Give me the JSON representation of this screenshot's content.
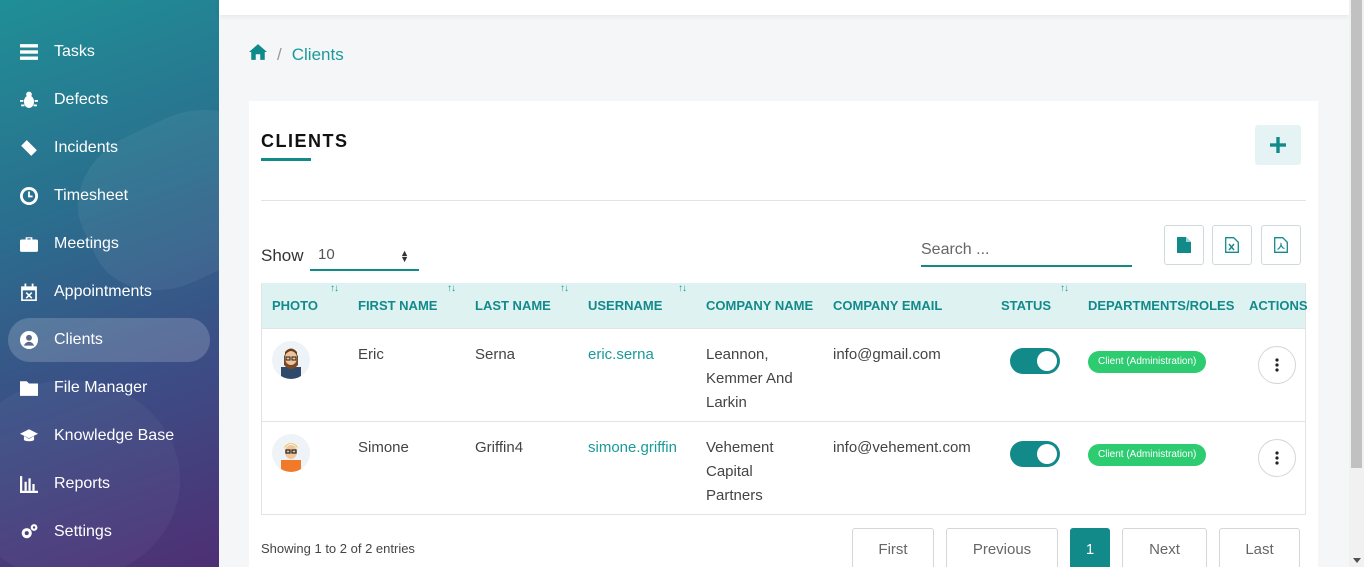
{
  "sidebar": {
    "items": [
      {
        "label": "Tasks",
        "icon": "tasks-icon"
      },
      {
        "label": "Defects",
        "icon": "bug-icon"
      },
      {
        "label": "Incidents",
        "icon": "ticket-icon"
      },
      {
        "label": "Timesheet",
        "icon": "clock-icon"
      },
      {
        "label": "Meetings",
        "icon": "briefcase-icon"
      },
      {
        "label": "Appointments",
        "icon": "calendar-icon"
      },
      {
        "label": "Clients",
        "icon": "user-circle-icon",
        "active": true
      },
      {
        "label": "File Manager",
        "icon": "folder-icon"
      },
      {
        "label": "Knowledge Base",
        "icon": "graduation-cap-icon"
      },
      {
        "label": "Reports",
        "icon": "bar-chart-icon"
      },
      {
        "label": "Settings",
        "icon": "gears-icon"
      }
    ]
  },
  "breadcrumb": {
    "current": "Clients",
    "separator": "/"
  },
  "card": {
    "title": "CLIENTS"
  },
  "controls": {
    "show_label": "Show",
    "show_value": "10",
    "search_placeholder": "Search ..."
  },
  "table": {
    "headers": {
      "photo": "PHOTO",
      "first_name": "FIRST NAME",
      "last_name": "LAST NAME",
      "username": "USERNAME",
      "company_name": "COMPANY NAME",
      "company_email": "COMPANY EMAIL",
      "status": "STATUS",
      "departments": "DEPARTMENTS/ROLES",
      "actions": "ACTIONS"
    },
    "sort_glyph": "↑↓",
    "rows": [
      {
        "first_name": "Eric",
        "last_name": "Serna",
        "username": "eric.serna",
        "company_line1": "Leannon,",
        "company_line2": "Kemmer And",
        "company_line3": "Larkin",
        "email": "info@gmail.com",
        "status_on": true,
        "role": "Client (Administration)"
      },
      {
        "first_name": "Simone",
        "last_name": "Griffin4",
        "username": "simone.griffin",
        "company_line1": "Vehement",
        "company_line2": "Capital",
        "company_line3": "Partners",
        "email": "info@vehement.com",
        "status_on": true,
        "role": "Client (Administration)"
      }
    ]
  },
  "footer": {
    "info": "Showing 1 to 2 of 2 entries",
    "pagination": {
      "first": "First",
      "previous": "Previous",
      "current": "1",
      "next": "Next",
      "last": "Last"
    }
  },
  "colors": {
    "accent": "#138a8a",
    "badge": "#2ecc71",
    "header_bg": "#dff2f2"
  }
}
